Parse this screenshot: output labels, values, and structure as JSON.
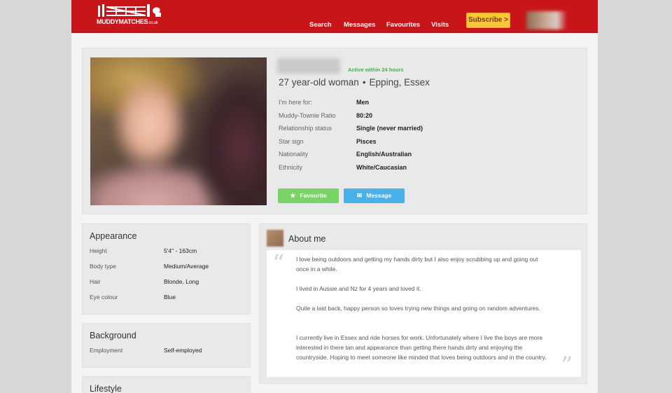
{
  "brand": {
    "logo_text": "MUDDYMATCHES",
    "logo_suffix": ".co.uk",
    "colors": {
      "header": "#c8151a",
      "subscribe": "#f7c63b",
      "favourite": "#78d464",
      "message": "#48b0ea",
      "active": "#3db54a"
    }
  },
  "nav": {
    "search": "Search",
    "messages": "Messages",
    "favourites": "Favourites",
    "visits": "Visits",
    "subscribe": "Subscribe >"
  },
  "profile": {
    "status": "Active within 24 hours",
    "age_gender": "27 year-old woman",
    "location": "Epping, Essex",
    "details": [
      {
        "label": "I'm here for:",
        "value": "Men"
      },
      {
        "label": "Muddy-Townie Ratio",
        "value": "80:20"
      },
      {
        "label": "Relationship status",
        "value": "Single (never married)"
      },
      {
        "label": "Star sign",
        "value": "Pisces"
      },
      {
        "label": "Nationality",
        "value": "English/Australian"
      },
      {
        "label": "Ethnicity",
        "value": "White/Caucasian"
      }
    ],
    "buttons": {
      "favourite": "Favourite",
      "message": "Message"
    }
  },
  "appearance": {
    "title": "Appearance",
    "rows": [
      {
        "label": "Height",
        "value": "5'4\" - 163cm"
      },
      {
        "label": "Body type",
        "value": "Medium/Average"
      },
      {
        "label": "Hair",
        "value": "Blonde, Long"
      },
      {
        "label": "Eye colour",
        "value": "Blue"
      }
    ]
  },
  "background": {
    "title": "Background",
    "rows": [
      {
        "label": "Employment",
        "value": "Self-employed"
      }
    ]
  },
  "lifestyle": {
    "title": "Lifestyle"
  },
  "about": {
    "title": "About me",
    "paragraphs": [
      "I love being outdoors and getting my hands dirty but I also enjoy scrubbing up and going out once in a while.",
      "I lived in Aussie and Nz for 4 years and loved it.",
      "Quite a laid back, happy person so loves trying new things and going on random adventures.",
      "I currently live in Essex and ride horses for work. Unfortunately where I live the boys are more interested in there tan and appearance than getting there hands dirty and enjoying the countryside. Hoping to meet someone like minded that loves being outdoors and in the country."
    ]
  }
}
